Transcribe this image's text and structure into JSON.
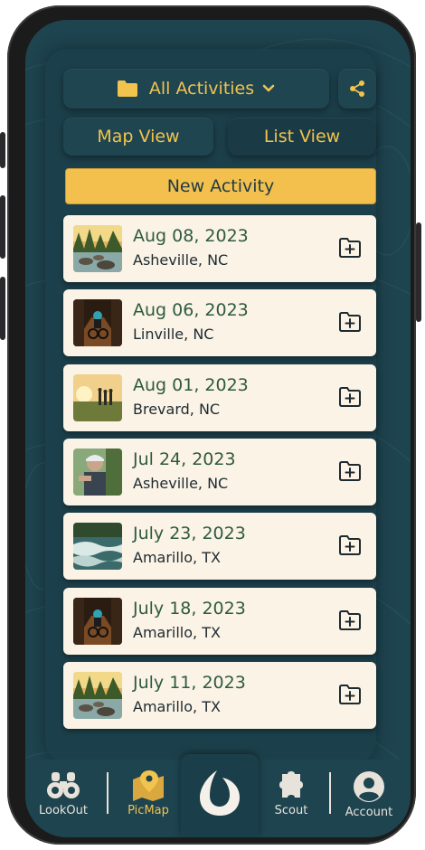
{
  "header": {
    "dropdown_label": "All Activities",
    "map_view_label": "Map View",
    "list_view_label": "List View",
    "new_activity_label": "New Activity"
  },
  "activities": [
    {
      "date": "Aug 08, 2023",
      "place": "Asheville, NC",
      "thumb": "river-forest"
    },
    {
      "date": "Aug 06, 2023",
      "place": "Linville, NC",
      "thumb": "bike-trail"
    },
    {
      "date": "Aug 01, 2023",
      "place": "Brevard, NC",
      "thumb": "sunset-hikers"
    },
    {
      "date": "Jul 24, 2023",
      "place": "Asheville, NC",
      "thumb": "biker-portrait"
    },
    {
      "date": "July 23, 2023",
      "place": "Amarillo, TX",
      "thumb": "rapids"
    },
    {
      "date": "July 18, 2023",
      "place": "Amarillo, TX",
      "thumb": "bike-trail"
    },
    {
      "date": "July 11, 2023",
      "place": "Amarillo, TX",
      "thumb": "river-forest"
    }
  ],
  "bottom_nav": [
    {
      "label": "LookOut",
      "icon": "binoculars-icon"
    },
    {
      "label": "PicMap",
      "icon": "map-pin-icon",
      "active": true
    },
    {
      "label": "",
      "icon": "app-logo-icon"
    },
    {
      "label": "Scout",
      "icon": "puzzle-icon"
    },
    {
      "label": "Account",
      "icon": "account-icon"
    }
  ],
  "colors": {
    "accent": "#f3c04d",
    "background": "#1e4450",
    "card": "#fbf3e6",
    "date_text": "#2e5b3d"
  }
}
